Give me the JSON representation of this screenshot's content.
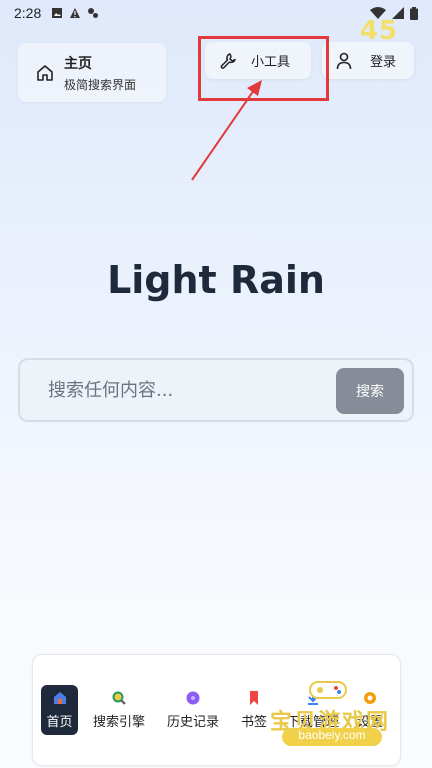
{
  "status_bar": {
    "time": "2:28",
    "badge": "45"
  },
  "home_card": {
    "title": "主页",
    "subtitle": "极简搜索界面"
  },
  "tools_button": {
    "label": "小工具"
  },
  "login_button": {
    "label": "登录"
  },
  "app_title": "Light Rain",
  "search": {
    "placeholder": "搜索任何内容...",
    "button_label": "搜索"
  },
  "bottom_nav": {
    "items": [
      {
        "label": "首页",
        "icon": "home-icon",
        "color": "#4f7ce8",
        "active": true
      },
      {
        "label": "搜索引擎",
        "icon": "search-icon",
        "color": "#1f9d55"
      },
      {
        "label": "历史记录",
        "icon": "history-icon",
        "color": "#8b5cf6"
      },
      {
        "label": "书签",
        "icon": "bookmark-icon",
        "color": "#ef4444"
      },
      {
        "label": "下载管理",
        "icon": "download-icon",
        "color": "#3b82f6"
      },
      {
        "label": "设置",
        "icon": "settings-icon",
        "color": "#f59e0b"
      }
    ]
  },
  "watermark": {
    "text": "宝贝游戏网",
    "url": "baobeiy.com"
  },
  "colors": {
    "highlight": "#e23a3a",
    "title": "#1e293b",
    "search_button": "#868d99"
  }
}
